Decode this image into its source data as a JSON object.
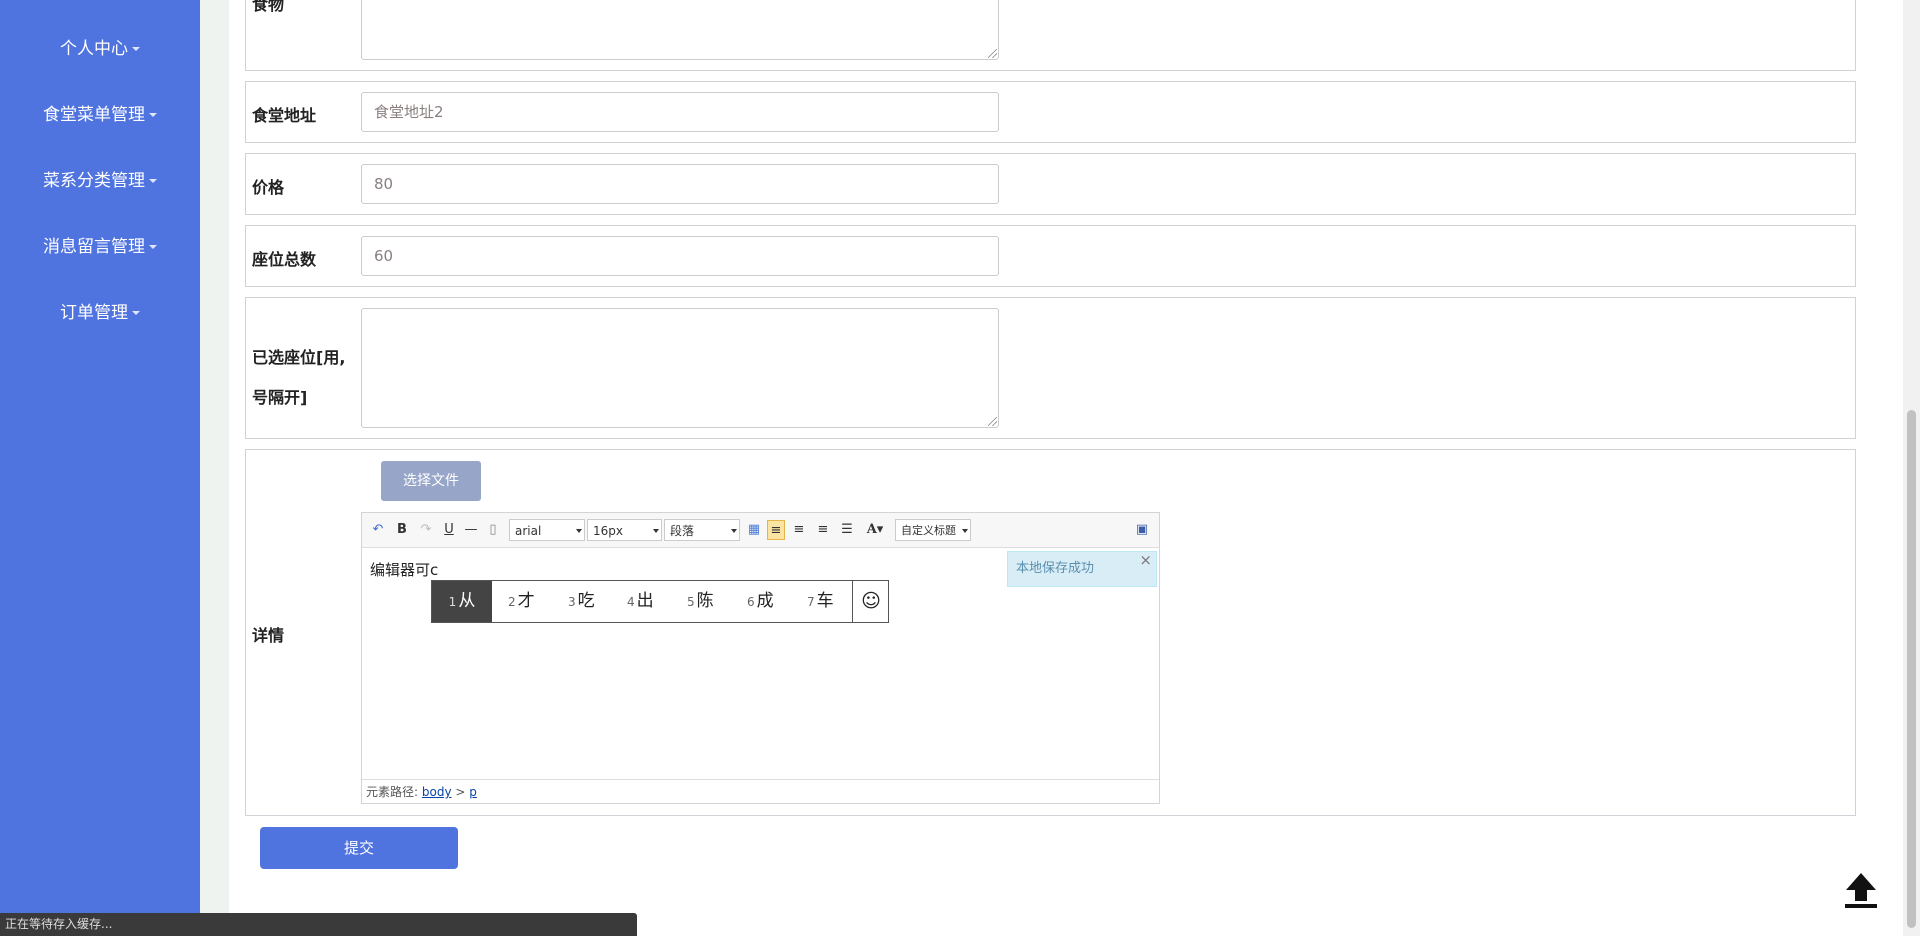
{
  "sidebar": {
    "items": [
      {
        "label": "个人中心"
      },
      {
        "label": "食堂菜单管理"
      },
      {
        "label": "菜系分类管理"
      },
      {
        "label": "消息留言管理"
      },
      {
        "label": "订单管理"
      }
    ]
  },
  "form": {
    "food_label": "食物",
    "address_label": "食堂地址",
    "address_value": "食堂地址2",
    "price_label": "价格",
    "price_value": "80",
    "seats_label": "座位总数",
    "seats_value": "60",
    "selected_seats_label_line1": "已选座位[用,",
    "selected_seats_label_line2": "号隔开]",
    "detail_label": "详情",
    "file_button": "选择文件",
    "submit": "提交"
  },
  "editor": {
    "font_family": "arial",
    "font_size": "16px",
    "paragraph": "段落",
    "custom_title": "自定义标题",
    "content": "编辑器可c",
    "save_tip": "本地保存成功",
    "path_label": "元素路径:",
    "path_body": "body",
    "path_sep": ">",
    "path_p": "p"
  },
  "ime": {
    "candidates": [
      {
        "n": "1",
        "ch": "从"
      },
      {
        "n": "2",
        "ch": "才"
      },
      {
        "n": "3",
        "ch": "吃"
      },
      {
        "n": "4",
        "ch": "出"
      },
      {
        "n": "5",
        "ch": "陈"
      },
      {
        "n": "6",
        "ch": "成"
      },
      {
        "n": "7",
        "ch": "车"
      }
    ],
    "emoji": "☺"
  },
  "status_bar": "正在等待存入缓存...",
  "colors": {
    "sidebar": "#4f73df",
    "accent": "#4f73df"
  }
}
